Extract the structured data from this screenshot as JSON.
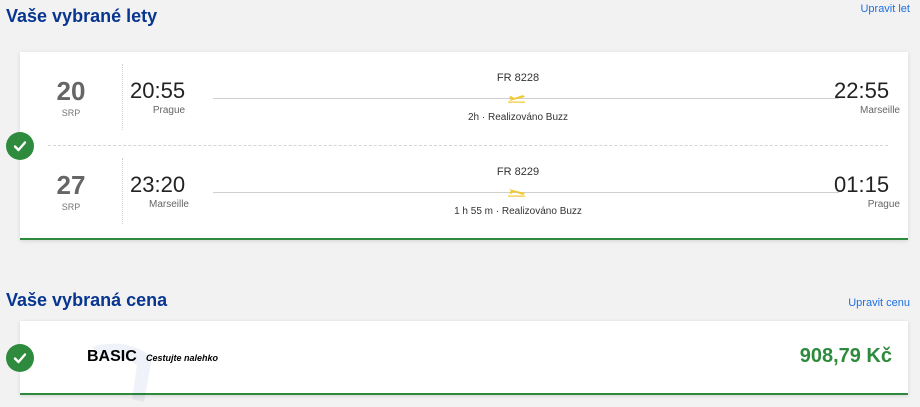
{
  "flights_section": {
    "title": "Vaše vybrané lety",
    "edit_label": "Upravit let"
  },
  "flights": [
    {
      "day": "20",
      "month": "SRP",
      "depart_time": "20:55",
      "depart_city": "Prague",
      "arrive_time": "22:55",
      "arrive_city": "Marseille",
      "flight_number": "FR 8228",
      "duration_info": "2h · Realizováno Buzz"
    },
    {
      "day": "27",
      "month": "SRP",
      "depart_time": "23:20",
      "depart_city": "Marseille",
      "arrive_time": "01:15",
      "arrive_city": "Prague",
      "flight_number": "FR 8229",
      "duration_info": "1 h 55 m · Realizováno Buzz"
    }
  ],
  "fare_section": {
    "title": "Vaše vybraná cena",
    "edit_label": "Upravit cenu",
    "fare_name": "BASIC",
    "fare_tagline": "Cestujte nalehko",
    "price": "908,79 Kč"
  },
  "colors": {
    "title_blue": "#073590",
    "link_blue": "#1f6fe0",
    "success_green": "#2e8b3d",
    "plane_yellow": "#f1c933"
  }
}
